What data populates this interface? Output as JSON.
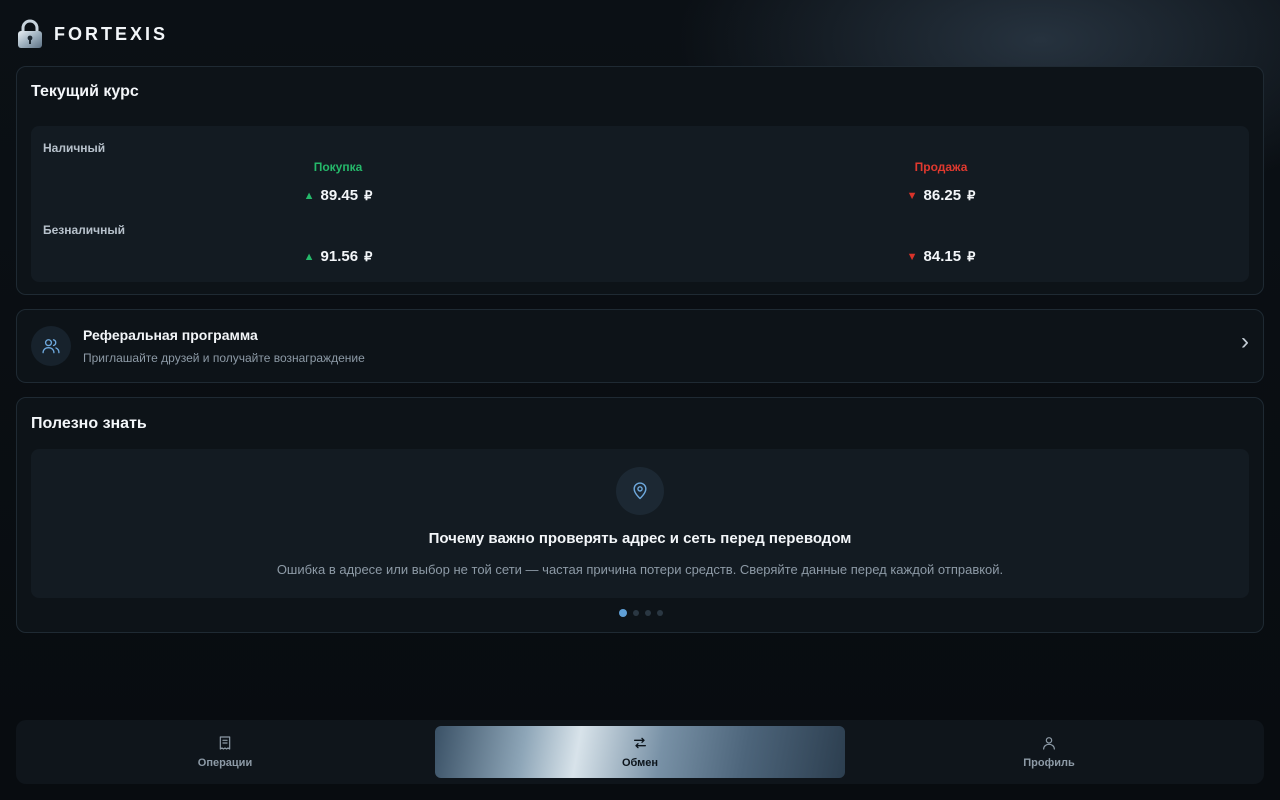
{
  "header": {
    "brand": "FORTEXIS",
    "logo_icon": "padlock-icon"
  },
  "rates": {
    "title": "Текущий курс",
    "buy_label": "Покупка",
    "sell_label": "Продажа",
    "buy_color": "#25b86a",
    "sell_color": "#e0392f",
    "cash": {
      "label": "Наличный",
      "buy": "89.45",
      "sell": "86.25"
    },
    "cashless": {
      "label": "Безналичный",
      "buy": "91.56",
      "sell": "84.15"
    },
    "currency": "₽"
  },
  "referral": {
    "title": "Реферальная программа",
    "subtitle": "Приглашайте друзей и получайте вознаграждение",
    "icon": "users-icon"
  },
  "useful": {
    "title": "Полезно знать",
    "slide": {
      "icon": "map-pin-icon",
      "title": "Почему важно проверять адрес и сеть перед переводом",
      "text": "Ошибка в адресе или выбор не той сети — частая причина потери средств. Сверяйте данные перед каждой отправкой."
    },
    "slides_total": 4,
    "active_slide": 1,
    "accent": "#5f9fd6"
  },
  "nav": {
    "items": [
      {
        "label": "Операции",
        "icon": "receipt-icon"
      },
      {
        "label": "Обмен",
        "icon": "swap-arrows-icon",
        "active": true
      },
      {
        "label": "Профиль",
        "icon": "user-icon"
      }
    ]
  }
}
